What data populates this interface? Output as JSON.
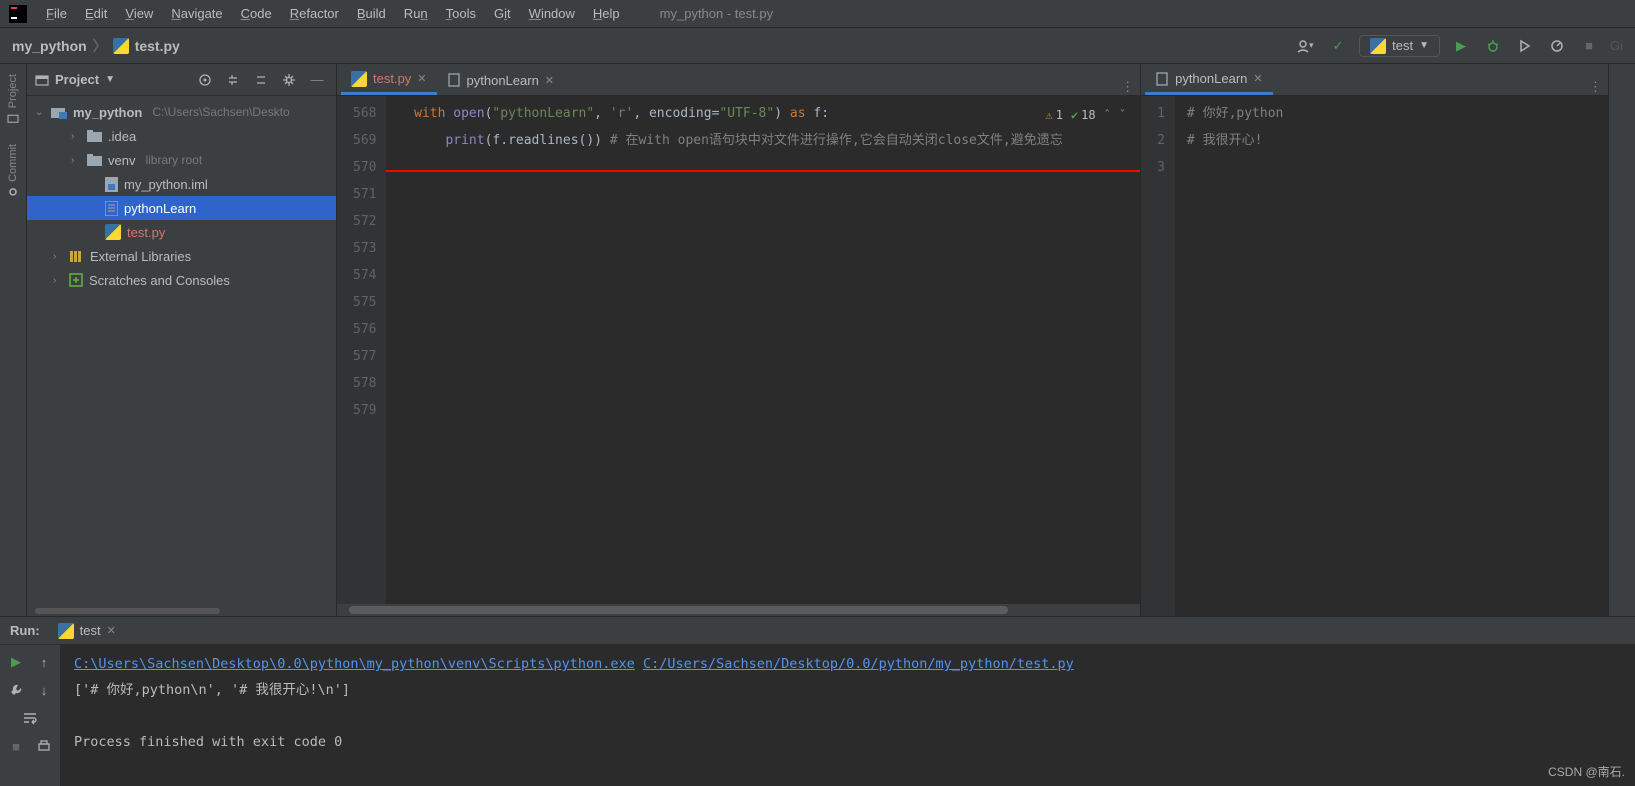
{
  "menubar": {
    "items": [
      {
        "l": "F",
        "rest": "ile"
      },
      {
        "l": "E",
        "rest": "dit"
      },
      {
        "l": "V",
        "rest": "iew"
      },
      {
        "l": "N",
        "rest": "avigate"
      },
      {
        "l": "C",
        "rest": "ode"
      },
      {
        "l": "R",
        "rest": "efactor"
      },
      {
        "l": "B",
        "rest": "uild"
      },
      {
        "l": "R",
        "rest": "u",
        "l2": "n"
      },
      {
        "l": "T",
        "rest": "ools"
      },
      {
        "l": "G",
        "rest": "i",
        "l2": "t"
      },
      {
        "l": "W",
        "rest": "indow"
      },
      {
        "l": "H",
        "rest": "elp"
      }
    ],
    "window_title": "my_python - test.py"
  },
  "breadcrumb": {
    "root": "my_python",
    "file": "test.py"
  },
  "toolbar": {
    "run_config": "test"
  },
  "sidebar": {
    "project_label": "Project",
    "commit_label": "Commit"
  },
  "project_panel": {
    "title": "Project"
  },
  "tree": {
    "root_name": "my_python",
    "root_path": "C:\\Users\\Sachsen\\Deskto",
    "items": [
      {
        "label": ".idea",
        "indent": 2,
        "type": "folder",
        "arrow": "›"
      },
      {
        "label": "venv",
        "hint": "library root",
        "indent": 2,
        "type": "folder",
        "arrow": "›"
      },
      {
        "label": "my_python.iml",
        "indent": 3,
        "type": "file-iml"
      },
      {
        "label": "pythonLearn",
        "indent": 3,
        "type": "file",
        "selected": true
      },
      {
        "label": "test.py",
        "indent": 3,
        "type": "file-py",
        "accent": true
      },
      {
        "label": "External Libraries",
        "indent": 1,
        "type": "lib",
        "arrow": "›"
      },
      {
        "label": "Scratches and Consoles",
        "indent": 1,
        "type": "scratch",
        "arrow": "›"
      }
    ]
  },
  "leftEditor": {
    "tabs": [
      {
        "label": "test.py",
        "active": true,
        "highlight": true,
        "py": true
      },
      {
        "label": "pythonLearn",
        "active": false,
        "py": false
      }
    ],
    "gutter": [
      "568",
      "569",
      "570",
      "571",
      "572",
      "573",
      "574",
      "575",
      "576",
      "577",
      "578",
      "579"
    ],
    "inspection": {
      "warn": "1",
      "ok": "18"
    },
    "code": {
      "l1": {
        "kw1": "with",
        "builtin1": "open",
        "p1": "(",
        "s1": "\"pythonLearn\"",
        "c1": ", ",
        "s2": "'r'",
        "c2": ", ",
        "kw2": "encoding",
        "eq": "=",
        "s3": "\"UTF-8\"",
        "p2": ") ",
        "kw3": "as",
        "sp": " ",
        "v": "f",
        "colon": ":"
      },
      "l2": {
        "builtin1": "print",
        "p1": "(",
        "v": "f.readlines()",
        "p2": ")",
        "sp": "   ",
        "comment": "# 在with open语句块中对文件进行操作,它会自动关闭close文件,避免遗忘"
      }
    }
  },
  "rightEditor": {
    "tabs": [
      {
        "label": "pythonLearn",
        "active": true
      }
    ],
    "gutter": [
      "1",
      "2",
      "3"
    ],
    "lines": [
      "# 你好,python",
      "# 我很开心!"
    ]
  },
  "run": {
    "label": "Run:",
    "tab": "test",
    "path1": "C:\\Users\\Sachsen\\Desktop\\0.0\\python\\my_python\\venv\\Scripts\\python.exe",
    "path2": "C:/Users/Sachsen/Desktop/0.0/python/my_python/test.py",
    "out": "['# 你好,python\\n', '# 我很开心!\\n']",
    "exit": "Process finished with exit code 0"
  },
  "branding": "CSDN @南石."
}
